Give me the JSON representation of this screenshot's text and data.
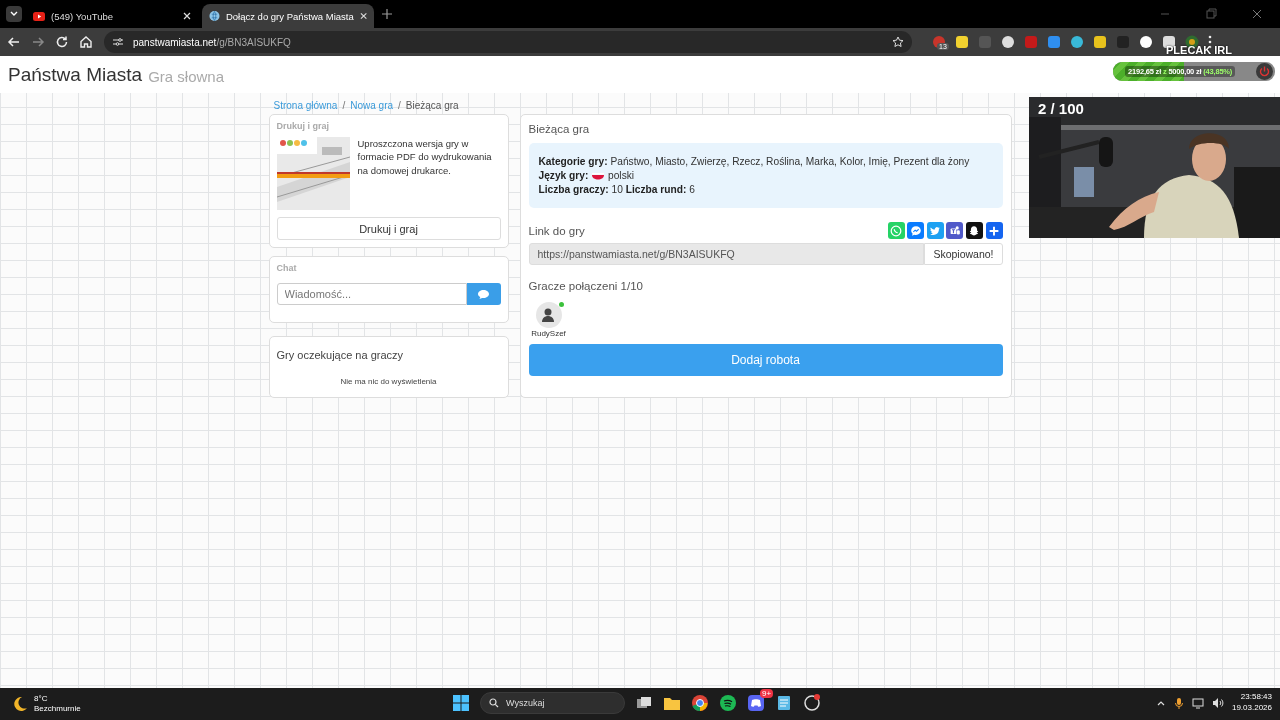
{
  "browser": {
    "tabs": [
      {
        "title": "(549) YouTube",
        "kind": "video",
        "selected": false
      },
      {
        "title": "Dołącz do gry Państwa Miasta",
        "kind": "globe",
        "selected": true
      }
    ],
    "url": {
      "host": "panstwamiasta.net",
      "path": "/g/BN3AISUKFQ"
    },
    "extension_badge": "13"
  },
  "header": {
    "title": "Państwa Miasta",
    "subtitle": "Gra słowna"
  },
  "breadcrumb": [
    {
      "label": "Strona główna",
      "kind": "link"
    },
    {
      "separator": "/",
      "label": "Nowa gra",
      "kind": "link"
    },
    {
      "separator": "/",
      "label": "Bieżąca gra",
      "kind": "current"
    }
  ],
  "print_card": {
    "heading": "Drukuj i graj",
    "description": "Uproszczona wersja gry w formacie PDF do wydrukowania na domowej drukarce.",
    "button": "Drukuj i graj"
  },
  "chat": {
    "heading": "Chat",
    "placeholder": "Wiadomość..."
  },
  "waiting_games": {
    "heading": "Gry oczekujące na graczy",
    "empty": "Nie ma nic do wyświetlenia"
  },
  "current_game": {
    "heading": "Bieżąca gra",
    "info": [
      {
        "label": "Kategorie gry:",
        "value": "Państwo, Miasto, Zwierzę, Rzecz, Roślina, Marka, Kolor, Imię, Prezent dla żony",
        "kind": "text"
      },
      {
        "label": "Język gry:",
        "value": "polski",
        "kind": "flag"
      },
      {
        "label": "Liczba graczy:",
        "value": "10",
        "kind": "text",
        "extra_label": "Liczba rund:",
        "extra_value": "6"
      }
    ],
    "link_label": "Link do gry",
    "link": "https://panstwamiasta.net/g/BN3AISUKFQ",
    "copy_button": "Skopiowano!",
    "share": [
      {
        "kind": "phone",
        "color": "#25d366"
      },
      {
        "kind": "bubble",
        "color": "#0a7cff"
      },
      {
        "kind": "bird",
        "color": "#1da1f2"
      },
      {
        "kind": "people",
        "color": "#5059c9"
      },
      {
        "kind": "ghost",
        "color": "#111111"
      },
      {
        "kind": "plus",
        "color": "#1565f0"
      }
    ],
    "players_heading": "Gracze połączeni 1/10",
    "players": [
      {
        "name": "RudySzef",
        "online": true
      }
    ],
    "add_bot_button": "Dodaj robota"
  },
  "stream_overlay": {
    "counter": "2 / 100",
    "title": "PLECAK IRL",
    "donation": {
      "raised": "2192,65 zł",
      "separator": "z",
      "goal": "5000,00 zł",
      "percent": "(43,85%)",
      "level": 0.4385
    }
  },
  "taskbar": {
    "temperature": "8°C",
    "weather": "Bezchmurnie",
    "search_placeholder": "Wyszukaj",
    "discord_badge": "9+",
    "time": "23:58:43",
    "date": "19.03.2026"
  }
}
